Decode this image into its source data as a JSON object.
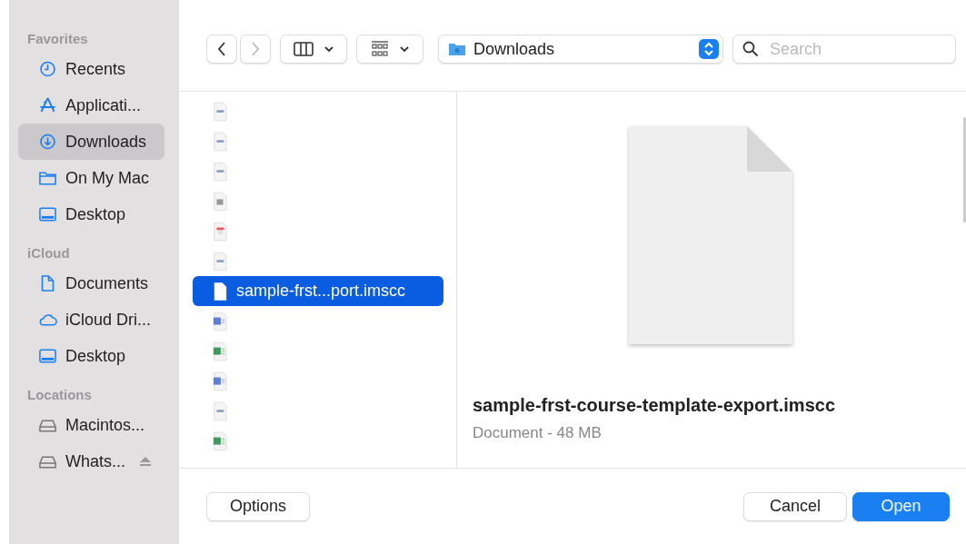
{
  "sidebar": {
    "sections": [
      {
        "title": "Favorites",
        "items": [
          {
            "label": "Recents",
            "kind": "clock",
            "selected": false
          },
          {
            "label": "Applicati...",
            "kind": "apps",
            "selected": false
          },
          {
            "label": "Downloads",
            "kind": "download",
            "selected": true
          },
          {
            "label": "On My Mac",
            "kind": "folder",
            "selected": false
          },
          {
            "label": "Desktop",
            "kind": "desktop",
            "selected": false
          }
        ]
      },
      {
        "title": "iCloud",
        "items": [
          {
            "label": "Documents",
            "kind": "doc",
            "selected": false
          },
          {
            "label": "iCloud Dri...",
            "kind": "cloud",
            "selected": false
          },
          {
            "label": "Desktop",
            "kind": "desktop",
            "selected": false
          }
        ]
      },
      {
        "title": "Locations",
        "items": [
          {
            "label": "Macintos...",
            "kind": "disk",
            "selected": false
          },
          {
            "label": "Whats...",
            "kind": "disk",
            "selected": false,
            "eject": true
          }
        ]
      }
    ]
  },
  "toolbar": {
    "location": "Downloads",
    "search": {
      "placeholder": "Search"
    }
  },
  "files": [
    {
      "kind": "image",
      "selected": false
    },
    {
      "kind": "image",
      "selected": false
    },
    {
      "kind": "image",
      "selected": false
    },
    {
      "kind": "text",
      "selected": false
    },
    {
      "kind": "pdf",
      "selected": false
    },
    {
      "kind": "image",
      "selected": false
    },
    {
      "kind": "blank",
      "name": "sample-frst...port.imscc",
      "selected": true
    },
    {
      "kind": "word",
      "selected": false
    },
    {
      "kind": "excel",
      "selected": false
    },
    {
      "kind": "word",
      "selected": false
    },
    {
      "kind": "image",
      "selected": false
    },
    {
      "kind": "excel",
      "selected": false
    }
  ],
  "preview": {
    "name": "sample-frst-course-template-export.imscc",
    "info": "Document - 48 MB"
  },
  "buttons": {
    "options": "Options",
    "cancel": "Cancel",
    "open": "Open"
  }
}
